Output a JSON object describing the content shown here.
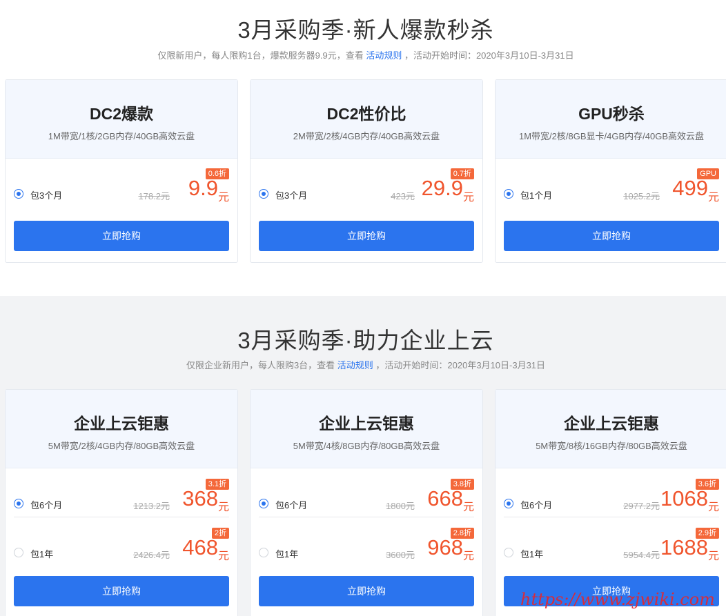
{
  "section1": {
    "title": "3月采购季·新人爆款秒杀",
    "subtitle_pre": "仅限新用户，每人限购1台，爆款服务器9.9元，查看 ",
    "subtitle_link": "活动规则",
    "subtitle_post": " ，活动开始时间：2020年3月10日-3月31日",
    "cards": [
      {
        "name": "DC2爆款",
        "spec": "1M带宽/1核/2GB内存/40GB高效云盘",
        "options": [
          {
            "period": "包3个月",
            "original": "178.2元",
            "price": "9.9",
            "unit": "元",
            "badge": "0.6折",
            "selected": true
          }
        ],
        "button": "立即抢购"
      },
      {
        "name": "DC2性价比",
        "spec": "2M带宽/2核/4GB内存/40GB高效云盘",
        "options": [
          {
            "period": "包3个月",
            "original": "423元",
            "price": "29.9",
            "unit": "元",
            "badge": "0.7折",
            "selected": true
          }
        ],
        "button": "立即抢购"
      },
      {
        "name": "GPU秒杀",
        "spec": "1M带宽/2核/8GB显卡/4GB内存/40GB高效云盘",
        "options": [
          {
            "period": "包1个月",
            "original": "1025.2元",
            "price": "499",
            "unit": "元",
            "badge": "GPU",
            "selected": true
          }
        ],
        "button": "立即抢购"
      }
    ]
  },
  "section2": {
    "title": "3月采购季·助力企业上云",
    "subtitle_pre": "仅限企业新用户，每人限购3台，查看 ",
    "subtitle_link": "活动规则",
    "subtitle_post": " ，活动开始时间：2020年3月10日-3月31日",
    "cards": [
      {
        "name": "企业上云钜惠",
        "spec": "5M带宽/2核/4GB内存/80GB高效云盘",
        "options": [
          {
            "period": "包6个月",
            "original": "1213.2元",
            "price": "368",
            "unit": "元",
            "badge": "3.1折",
            "selected": true
          },
          {
            "period": "包1年",
            "original": "2426.4元",
            "price": "468",
            "unit": "元",
            "badge": "2折",
            "selected": false
          }
        ],
        "button": "立即抢购"
      },
      {
        "name": "企业上云钜惠",
        "spec": "5M带宽/4核/8GB内存/80GB高效云盘",
        "options": [
          {
            "period": "包6个月",
            "original": "1800元",
            "price": "668",
            "unit": "元",
            "badge": "3.8折",
            "selected": true
          },
          {
            "period": "包1年",
            "original": "3600元",
            "price": "968",
            "unit": "元",
            "badge": "2.8折",
            "selected": false
          }
        ],
        "button": "立即抢购"
      },
      {
        "name": "企业上云钜惠",
        "spec": "5M带宽/8核/16GB内存/80GB高效云盘",
        "options": [
          {
            "period": "包6个月",
            "original": "2977.2元",
            "price": "1068",
            "unit": "元",
            "badge": "3.6折",
            "selected": true
          },
          {
            "period": "包1年",
            "original": "5954.4元",
            "price": "1688",
            "unit": "元",
            "badge": "2.9折",
            "selected": false
          }
        ],
        "button": "立即抢购"
      }
    ]
  },
  "watermark": "https://www.zjwiki.com",
  "colors": {
    "accent": "#2b74ee",
    "price": "#f0552d",
    "badge": "#f4683a"
  }
}
